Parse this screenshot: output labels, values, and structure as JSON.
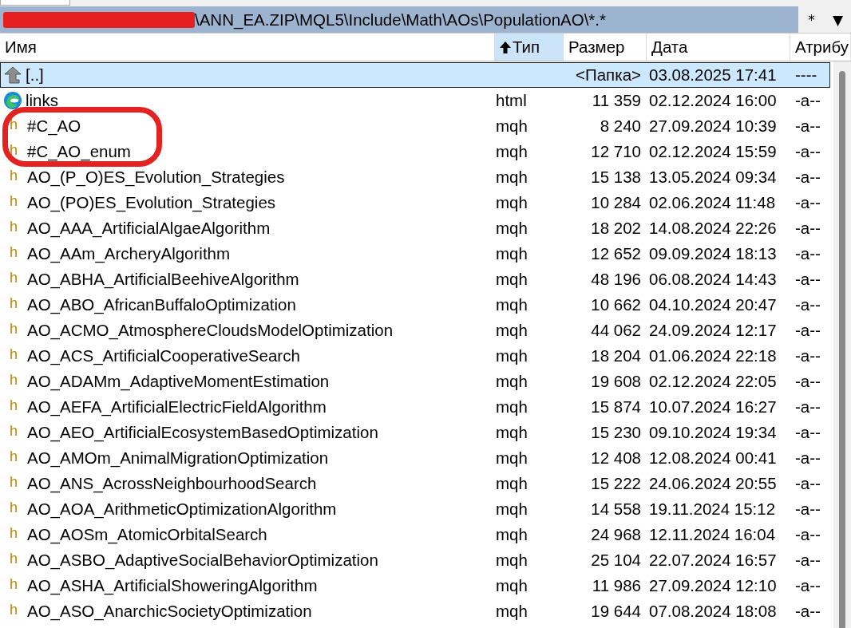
{
  "path": {
    "text": "\\ANN_EA.ZIP\\MQL5\\Include\\Math\\AOs\\PopulationAO\\*.*",
    "redacted": true
  },
  "path_buttons": [
    "*",
    "▼"
  ],
  "columns": [
    {
      "label": "Имя",
      "sorted": false
    },
    {
      "label": "Тип",
      "sorted": true
    },
    {
      "label": "Размер",
      "sorted": false
    },
    {
      "label": "Дата",
      "sorted": false
    },
    {
      "label": "Атрибу",
      "sorted": false
    }
  ],
  "rows": [
    {
      "kind": "parent",
      "name": "[..]",
      "type": "",
      "size": "<Папка>",
      "date": "03.08.2025 17:41",
      "attr": "----",
      "selected": true,
      "circled": false
    },
    {
      "kind": "html",
      "name": "links",
      "type": "html",
      "size": "11 359",
      "date": "02.12.2024 16:00",
      "attr": "-a--",
      "selected": false,
      "circled": false
    },
    {
      "kind": "mqh",
      "icon_text": "h",
      "name": "#C_AO",
      "type": "mqh",
      "size": "8 240",
      "date": "27.09.2024 10:39",
      "attr": "-a--",
      "selected": false,
      "circled": true
    },
    {
      "kind": "mqh",
      "icon_text": "h",
      "name": "#C_AO_enum",
      "type": "mqh",
      "size": "12 710",
      "date": "02.12.2024 15:59",
      "attr": "-a--",
      "selected": false,
      "circled": true
    },
    {
      "kind": "mqh",
      "icon_text": "h",
      "name": "AO_(P_O)ES_Evolution_Strategies",
      "type": "mqh",
      "size": "15 138",
      "date": "13.05.2024 09:34",
      "attr": "-a--",
      "selected": false,
      "circled": false
    },
    {
      "kind": "mqh",
      "icon_text": "h",
      "name": "AO_(PO)ES_Evolution_Strategies",
      "type": "mqh",
      "size": "10 284",
      "date": "02.06.2024 11:48",
      "attr": "-a--",
      "selected": false,
      "circled": false
    },
    {
      "kind": "mqh",
      "icon_text": "h",
      "name": "AO_AAA_ArtificialAlgaeAlgorithm",
      "type": "mqh",
      "size": "18 202",
      "date": "14.08.2024 22:26",
      "attr": "-a--",
      "selected": false,
      "circled": false
    },
    {
      "kind": "mqh",
      "icon_text": "h",
      "name": "AO_AAm_ArcheryAlgorithm",
      "type": "mqh",
      "size": "12 652",
      "date": "09.09.2024 18:13",
      "attr": "-a--",
      "selected": false,
      "circled": false
    },
    {
      "kind": "mqh",
      "icon_text": "h",
      "name": "AO_ABHA_ArtificialBeehiveAlgorithm",
      "type": "mqh",
      "size": "48 196",
      "date": "06.08.2024 14:43",
      "attr": "-a--",
      "selected": false,
      "circled": false
    },
    {
      "kind": "mqh",
      "icon_text": "h",
      "name": "AO_ABO_AfricanBuffaloOptimization",
      "type": "mqh",
      "size": "10 662",
      "date": "04.10.2024 20:47",
      "attr": "-a--",
      "selected": false,
      "circled": false
    },
    {
      "kind": "mqh",
      "icon_text": "h",
      "name": "AO_ACMO_AtmosphereCloudsModelOptimization",
      "type": "mqh",
      "size": "44 062",
      "date": "24.09.2024 12:17",
      "attr": "-a--",
      "selected": false,
      "circled": false
    },
    {
      "kind": "mqh",
      "icon_text": "h",
      "name": "AO_ACS_ArtificialCooperativeSearch",
      "type": "mqh",
      "size": "18 204",
      "date": "01.06.2024 22:18",
      "attr": "-a--",
      "selected": false,
      "circled": false
    },
    {
      "kind": "mqh",
      "icon_text": "h",
      "name": "AO_ADAMm_AdaptiveMomentEstimation",
      "type": "mqh",
      "size": "19 608",
      "date": "02.12.2024 22:05",
      "attr": "-a--",
      "selected": false,
      "circled": false
    },
    {
      "kind": "mqh",
      "icon_text": "h",
      "name": "AO_AEFA_ArtificialElectricFieldAlgorithm",
      "type": "mqh",
      "size": "15 874",
      "date": "10.07.2024 16:27",
      "attr": "-a--",
      "selected": false,
      "circled": false
    },
    {
      "kind": "mqh",
      "icon_text": "h",
      "name": "AO_AEO_ArtificialEcosystemBasedOptimization",
      "type": "mqh",
      "size": "15 230",
      "date": "09.10.2024 19:34",
      "attr": "-a--",
      "selected": false,
      "circled": false
    },
    {
      "kind": "mqh",
      "icon_text": "h",
      "name": "AO_AMOm_AnimalMigrationOptimization",
      "type": "mqh",
      "size": "12 408",
      "date": "12.08.2024 00:41",
      "attr": "-a--",
      "selected": false,
      "circled": false
    },
    {
      "kind": "mqh",
      "icon_text": "h",
      "name": "AO_ANS_AcrossNeighbourhoodSearch",
      "type": "mqh",
      "size": "15 222",
      "date": "24.06.2024 20:55",
      "attr": "-a--",
      "selected": false,
      "circled": false
    },
    {
      "kind": "mqh",
      "icon_text": "h",
      "name": "AO_AOA_ArithmeticOptimizationAlgorithm",
      "type": "mqh",
      "size": "14 558",
      "date": "19.11.2024 15:12",
      "attr": "-a--",
      "selected": false,
      "circled": false
    },
    {
      "kind": "mqh",
      "icon_text": "h",
      "name": "AO_AOSm_AtomicOrbitalSearch",
      "type": "mqh",
      "size": "24 968",
      "date": "12.11.2024 16:04",
      "attr": "-a--",
      "selected": false,
      "circled": false
    },
    {
      "kind": "mqh",
      "icon_text": "h",
      "name": "AO_ASBO_AdaptiveSocialBehaviorOptimization",
      "type": "mqh",
      "size": "25 104",
      "date": "22.07.2024 16:57",
      "attr": "-a--",
      "selected": false,
      "circled": false
    },
    {
      "kind": "mqh",
      "icon_text": "h",
      "name": "AO_ASHA_ArtificialShoweringAlgorithm",
      "type": "mqh",
      "size": "11 986",
      "date": "27.09.2024 12:10",
      "attr": "-a--",
      "selected": false,
      "circled": false
    },
    {
      "kind": "mqh",
      "icon_text": "h",
      "name": "AO_ASO_AnarchicSocietyOptimization",
      "type": "mqh",
      "size": "19 644",
      "date": "07.08.2024 18:08",
      "attr": "-a--",
      "selected": false,
      "circled": false
    }
  ]
}
